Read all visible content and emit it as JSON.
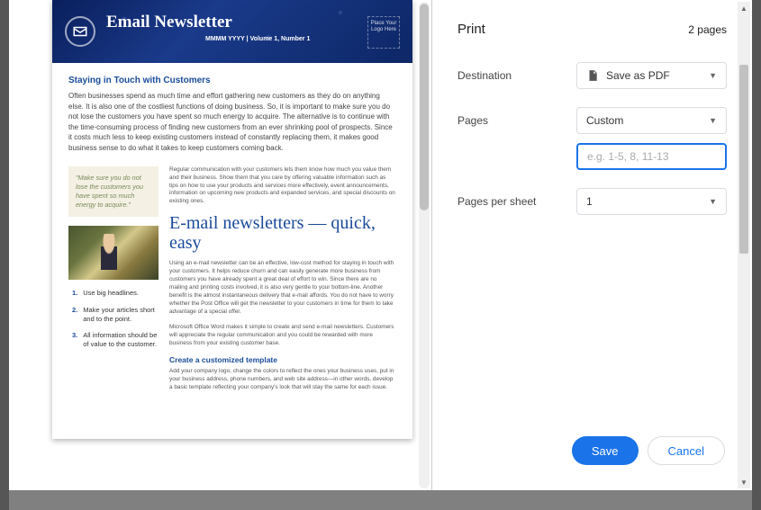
{
  "preview": {
    "header": {
      "title": "Email Newsletter",
      "meta_date": "MMMM YYYY",
      "meta_sep": "  |  ",
      "meta_issue": "Volume 1, Number 1",
      "logo_placeholder": "Place Your Logo Here"
    },
    "section1": {
      "title": "Staying in Touch with Customers",
      "body": "Often businesses spend as much time and effort gathering new customers as they do on anything else. It is also one of the costliest functions of doing business. So, it is important to make sure you do not lose the customers you have spent so much energy to acquire. The alternative is to continue with the time-consuming process of finding new customers from an ever shrinking pool of prospects. Since it costs much less to keep existing customers instead of constantly replacing them, it makes good business sense to do what it takes to keep customers coming back."
    },
    "quote": "\"Make sure you do not lose the customers you have spent so much energy to acquire.\"",
    "tips": [
      {
        "n": "1.",
        "t": "Use big headlines."
      },
      {
        "n": "2.",
        "t": "Make your articles short and to the point."
      },
      {
        "n": "3.",
        "t": "All information should be of value to the customer."
      }
    ],
    "right": {
      "intro": "Regular communication with your customers lets them know how much you value them and their business. Show them that you care by offering valuable information such as tips on how to use your products and services more effectively, event announcements, information on upcoming new products and expanded services, and special discounts on existing ones.",
      "heading": "E-mail newsletters — quick, easy",
      "para1": "Using an e-mail newsletter can be an effective, low-cost method for staying in touch with your customers. It helps reduce churn and can easily generate more business from customers you have already spent a great deal of effort to win. Since there are no mailing and printing costs involved, it is also very gentle to your bottom-line. Another benefit is the almost instantaneous delivery that e-mail affords. You do not have to worry whether the Post Office will get the newsletter to your customers in time for them to take advantage of a special offer.",
      "para1b": "Microsoft Office Word makes it simple to create and send e-mail newsletters. Customers will appreciate the regular communication and you could be rewarded with more business from your existing customer base.",
      "subheading": "Create a customized template",
      "para2": "Add your company logo, change the colors to reflect the ones your business uses, put in your business address, phone numbers, and web site address—in other words, develop a basic template reflecting your company's look that will stay the same for each issue."
    }
  },
  "panel": {
    "title": "Print",
    "page_count": "2 pages",
    "rows": {
      "destination_label": "Destination",
      "destination_value": "Save as PDF",
      "pages_label": "Pages",
      "pages_value": "Custom",
      "pages_input_placeholder": "e.g. 1-5, 8, 11-13",
      "pps_label": "Pages per sheet",
      "pps_value": "1"
    },
    "buttons": {
      "save": "Save",
      "cancel": "Cancel"
    }
  }
}
